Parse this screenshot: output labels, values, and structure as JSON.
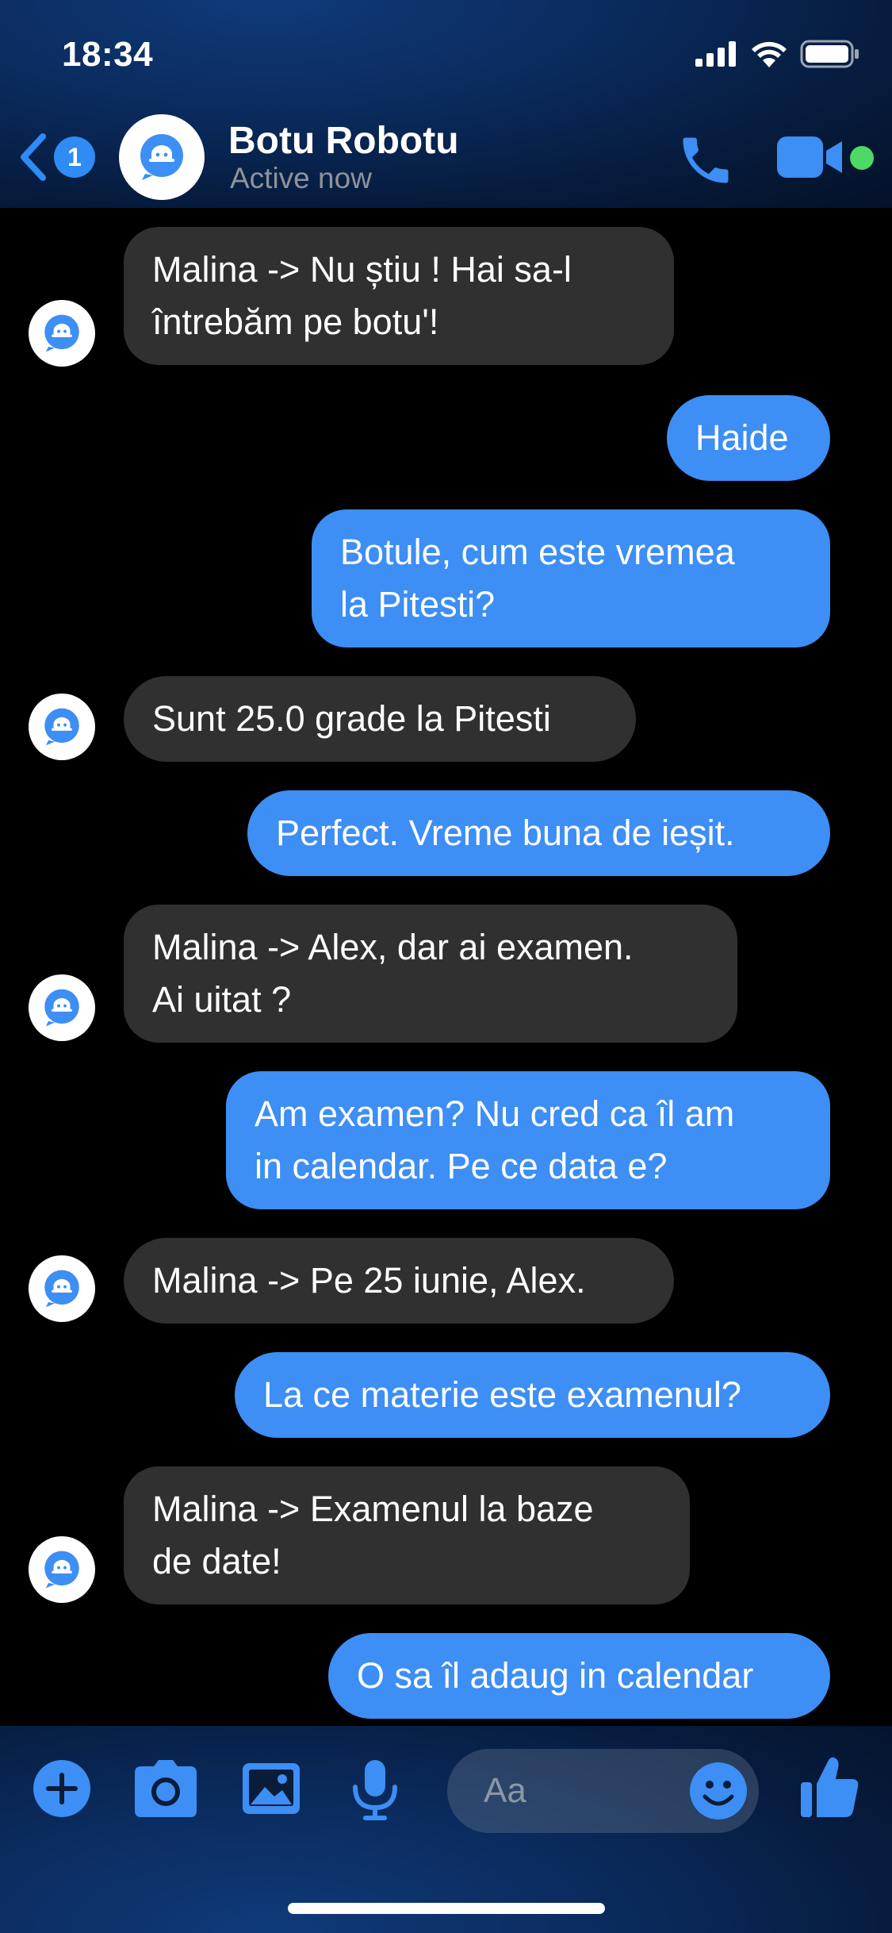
{
  "status_bar": {
    "time": "18:34",
    "icons": [
      "signal-icon",
      "wifi-icon",
      "battery-icon"
    ]
  },
  "header": {
    "back_badge": "1",
    "contact_name": "Botu Robotu",
    "contact_status": "Active now",
    "icons": [
      "back-chevron-icon",
      "bot-avatar-icon",
      "phone-icon",
      "video-camera-icon"
    ]
  },
  "messages": [
    {
      "sender": "bot",
      "lines": [
        "Malina -> Nu știu ! Hai sa-l",
        "întrebăm pe botu'!"
      ]
    },
    {
      "sender": "me",
      "lines": [
        "Haide"
      ]
    },
    {
      "sender": "me",
      "lines": [
        "Botule, cum este vremea",
        "la Pitesti?"
      ]
    },
    {
      "sender": "bot",
      "lines": [
        "Sunt 25.0 grade la Pitesti"
      ]
    },
    {
      "sender": "me",
      "lines": [
        "Perfect. Vreme buna de ieșit."
      ]
    },
    {
      "sender": "bot",
      "lines": [
        "Malina -> Alex, dar ai examen.",
        "Ai uitat ?"
      ]
    },
    {
      "sender": "me",
      "lines": [
        "Am examen? Nu cred ca îl am",
        "in calendar. Pe ce data e?"
      ]
    },
    {
      "sender": "bot",
      "lines": [
        "Malina -> Pe 25 iunie, Alex."
      ]
    },
    {
      "sender": "me",
      "lines": [
        "La ce materie este examenul?"
      ]
    },
    {
      "sender": "bot",
      "lines": [
        "Malina -> Examenul la baze",
        "de date!"
      ]
    },
    {
      "sender": "me",
      "lines": [
        "O sa îl adaug in calendar"
      ]
    }
  ],
  "composer": {
    "placeholder": "Aa",
    "icons": [
      "plus-icon",
      "camera-icon",
      "photo-icon",
      "microphone-icon",
      "emoji-icon",
      "thumbs-up-icon"
    ]
  },
  "colors": {
    "accent": "#3d8ef5",
    "incoming_bubble": "#303030",
    "online": "#4cd964",
    "background": "#000000"
  }
}
